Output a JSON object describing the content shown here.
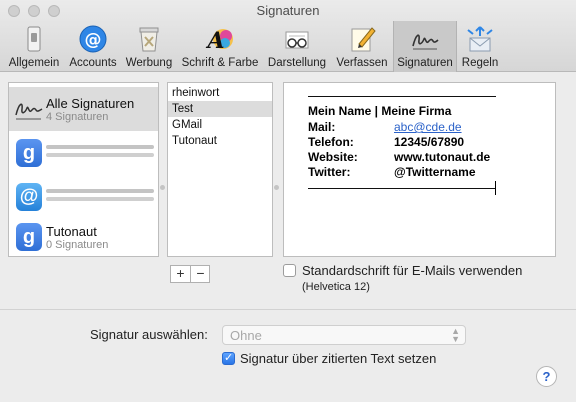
{
  "window": {
    "title": "Signaturen"
  },
  "toolbar": {
    "items": [
      {
        "label": "Allgemein",
        "icon": "switch-icon"
      },
      {
        "label": "Accounts",
        "icon": "at-icon"
      },
      {
        "label": "Werbung",
        "icon": "trash-icon"
      },
      {
        "label": "Schrift & Farbe",
        "icon": "font-color-icon"
      },
      {
        "label": "Darstellung",
        "icon": "glasses-icon"
      },
      {
        "label": "Verfassen",
        "icon": "pencil-icon"
      },
      {
        "label": "Signaturen",
        "icon": "signature-icon"
      },
      {
        "label": "Regeln",
        "icon": "rules-icon"
      }
    ]
  },
  "accounts": [
    {
      "name": "Alle Signaturen",
      "count": "4 Signaturen"
    },
    {
      "name": "",
      "count": ""
    },
    {
      "name": "",
      "count": ""
    },
    {
      "name": "Tutonaut",
      "count": "0 Signaturen"
    }
  ],
  "signatures": [
    "rheinwort",
    "Test",
    "GMail",
    "Tutonaut"
  ],
  "addremove": {
    "add": "+",
    "remove": "−"
  },
  "preview": {
    "line1": "Mein Name | Meine Firma",
    "rows": [
      {
        "key": "Mail:",
        "value": "abc@cde.de"
      },
      {
        "key": "Telefon:",
        "value": "12345/67890"
      },
      {
        "key": "Website:",
        "value": "www.tutonaut.de"
      },
      {
        "key": "Twitter:",
        "value": "@Twittername"
      }
    ]
  },
  "default_font": {
    "label": "Standardschrift für E-Mails verwenden",
    "hint": "(Helvetica 12)",
    "checked": false
  },
  "choose": {
    "label": "Signatur auswählen:",
    "value": "Ohne"
  },
  "quote": {
    "label": "Signatur über zitierten Text setzen",
    "checked": true
  },
  "help": "?"
}
